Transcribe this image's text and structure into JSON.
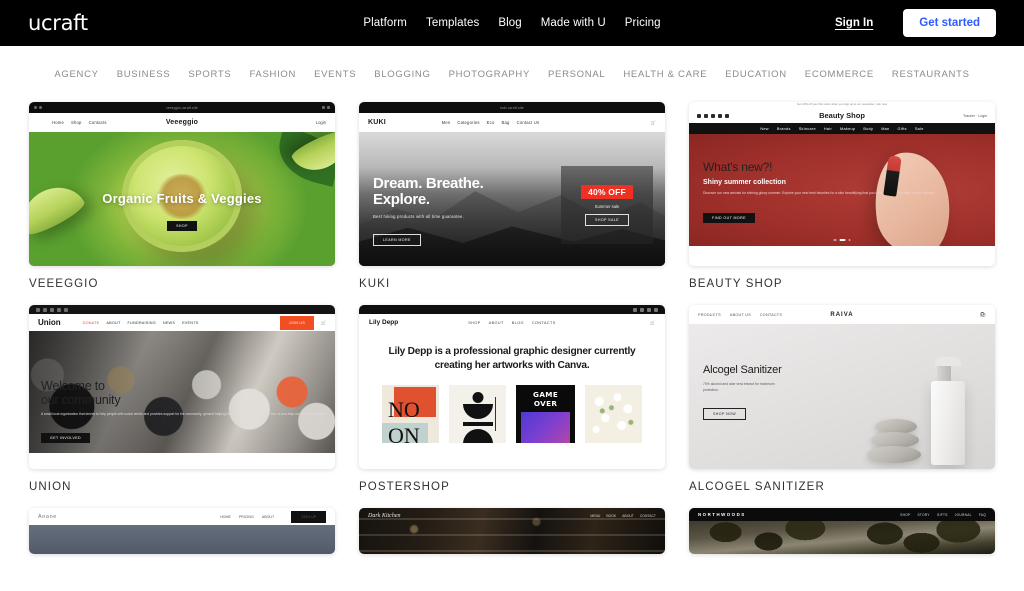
{
  "header": {
    "logo": "ucraft",
    "nav": [
      "Platform",
      "Templates",
      "Blog",
      "Made with U",
      "Pricing"
    ],
    "sign_in": "Sign In",
    "get_started": "Get started",
    "accent_button_text_color": "#2f5bff",
    "background": "#000000"
  },
  "categories": [
    "AGENCY",
    "BUSINESS",
    "SPORTS",
    "FASHION",
    "EVENTS",
    "BLOGGING",
    "PHOTOGRAPHY",
    "PERSONAL",
    "HEALTH & CARE",
    "EDUCATION",
    "ECOMMERCE",
    "RESTAURANTS"
  ],
  "templates": [
    {
      "title": "VEEEGGIO",
      "site": {
        "url": "veeeggio.ucraft.site",
        "brand": "Veeeggio",
        "nav": [
          "Home",
          "Shop",
          "Contacts"
        ],
        "right": "Login",
        "headline": "Organic Fruits & Veggies",
        "button": "SHOP"
      }
    },
    {
      "title": "KUKI",
      "site": {
        "url": "kuki.ucraft.site",
        "brand": "KUKI",
        "nav": [
          "Men",
          "Categories",
          "Eco",
          "Bag",
          "Contact Us"
        ],
        "headline_line1": "Dream. Breathe.",
        "headline_line2": "Explore.",
        "subtext": "Best hiking products with all time guarantee.",
        "button": "LEARN MORE",
        "promo_badge": "40% OFF",
        "promo_sub": "Summer sale",
        "promo_button": "SHOP SALE",
        "badge_color": "#ef3124"
      }
    },
    {
      "title": "BEAUTY SHOP",
      "site": {
        "topbar": "Get 10% off your first order when you sign up to our newsletter. Join now",
        "brand": "Beauty Shop",
        "nav": [
          "New",
          "Brands",
          "Skincare",
          "Hair",
          "Makeup",
          "Body",
          "Man",
          "Gifts",
          "Sale"
        ],
        "right": "Tracker · Login",
        "headline": "What's new?!",
        "subheadline": "Shiny summer collection",
        "subtext": "Discover our new arrivals for shining glowy summer. Explore your new best favorites for a skin beautifying that you can't imagine your daily routine without.",
        "button": "FIND OUT MORE"
      }
    },
    {
      "title": "UNION",
      "site": {
        "brand": "Union",
        "nav": [
          "DONATE",
          "ABOUT",
          "FUNDRAISING",
          "NEWS",
          "EVENTS"
        ],
        "cta": "JOIN US",
        "headline_line1": "Welcome to",
        "headline_line2": "our community",
        "subtext": "A small local organization that strives to help people with social needs and provides support for the community, general helping hands and funds for a cause. Join us and help our community grow.",
        "button": "GET INVOLVED",
        "accent": "#f04e23"
      }
    },
    {
      "title": "POSTERSHOP",
      "site": {
        "brand": "Lily Depp",
        "nav": [
          "SHOP",
          "ABOUT",
          "BLOG",
          "CONTACTS"
        ],
        "headline": "Lily Depp is a professional graphic designer currently creating her artworks with Canva.",
        "posters": [
          "NO ON",
          "Shapes",
          "GAME OVER",
          "Floral"
        ]
      }
    },
    {
      "title": "ALCOGEL SANITIZER",
      "site": {
        "brand": "RAIVA",
        "nav": [
          "PRODUCTS",
          "ABOUT US",
          "CONTACTS"
        ],
        "headline": "Alcogel Sanitizer",
        "subtext": "70% alcohol and aloe vera extract for maximum protection.",
        "button": "SHOP NOW"
      }
    },
    {
      "title": "",
      "site": {
        "brand": "Anane",
        "nav": [
          "HOME",
          "PRICING",
          "ABOUT"
        ],
        "cta": "SIGN UP"
      }
    },
    {
      "title": "",
      "site": {
        "brand": "Dark Kitchen",
        "nav": [
          "MENU",
          "BOOK",
          "ABOUT",
          "CONTACT"
        ]
      }
    },
    {
      "title": "",
      "site": {
        "brand": "NORTHWOODS",
        "nav": [
          "SHOP",
          "STORY",
          "GIFTS",
          "JOURNAL",
          "FAQ"
        ]
      }
    }
  ]
}
